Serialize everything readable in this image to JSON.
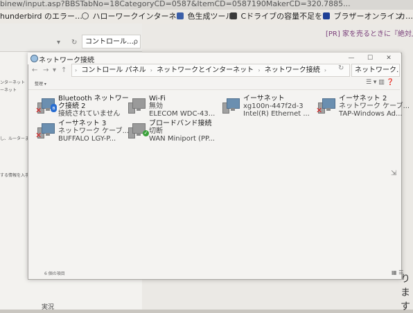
{
  "browser": {
    "url": "binew/input.asp?BBSTabNo=18CategoryCD=0587&ItemCD=0587190MakerCD=320.7885...",
    "bookmarks": [
      {
        "label": "hunderbird のエラー…",
        "icon": "page-icon",
        "color": "#cfcfcf"
      },
      {
        "label": "ハローワークインターネ…",
        "icon": "globe-icon",
        "color": "#e8e8e8"
      },
      {
        "label": "色生成ツール",
        "icon": "tool-icon",
        "color": "#3b5fa8"
      },
      {
        "label": "Cドライブの容量不足を…",
        "icon": "page-icon",
        "color": "#3a3a3a"
      },
      {
        "label": "ブラザーオンライン",
        "icon": "brother-icon",
        "color": "#1d3f95"
      },
      {
        "label": "カ…",
        "icon": "page-icon",
        "color": "#cfcfcf"
      }
    ]
  },
  "bg_window": {
    "address": "コントロール…",
    "search_glyph": "ρ",
    "side_texts": [
      "ンターネット",
      "ーネット",
      "し、ルーターまたはア",
      "する情報を入手して"
    ]
  },
  "bg_page": {
    "pr_text": "[PR] 家を売るときに『絶対』",
    "cut_text": "ります"
  },
  "window": {
    "title": "ネットワーク接続",
    "controls": [
      "—",
      "☐",
      "✕"
    ]
  },
  "address_bar": {
    "crumbs": [
      "コントロール パネル",
      "ネットワークとインターネット",
      "ネットワーク接続"
    ],
    "search_placeholder": "ネットワーク…"
  },
  "toolbar": {
    "organize": "整理 ▾",
    "view_glyphs": "☰ ▾  ▥  ❓"
  },
  "adapters": [
    {
      "name": "Bluetooth ネットワー",
      "name2": "ク接続 2",
      "status": "接続されていません",
      "device": "",
      "state": "disconnected-bt"
    },
    {
      "name": "Wi-Fi",
      "name2": "",
      "status": "無効",
      "device": "ELECOM WDC-43...",
      "state": "disabled"
    },
    {
      "name": "イーサネット",
      "name2": "",
      "status": "xg100n-447f2d-3",
      "device": "Intel(R) Ethernet ...",
      "state": "connected"
    },
    {
      "name": "イーサネット 2",
      "name2": "",
      "status": "ネットワーク ケーブ...",
      "device": "TAP-Windows Ad...",
      "state": "disconnected"
    },
    {
      "name": "イーサネット 3",
      "name2": "",
      "status": "ネットワーク ケーブ...",
      "device": "BUFFALO LGY-P...",
      "state": "disconnected"
    },
    {
      "name": "ブロードバンド接続",
      "name2": "",
      "status": "切断",
      "device": "WAN Miniport (PP...",
      "state": "broadband"
    }
  ],
  "status_bar": {
    "item_count": "6 個の項目"
  },
  "bottom_text": "実況"
}
